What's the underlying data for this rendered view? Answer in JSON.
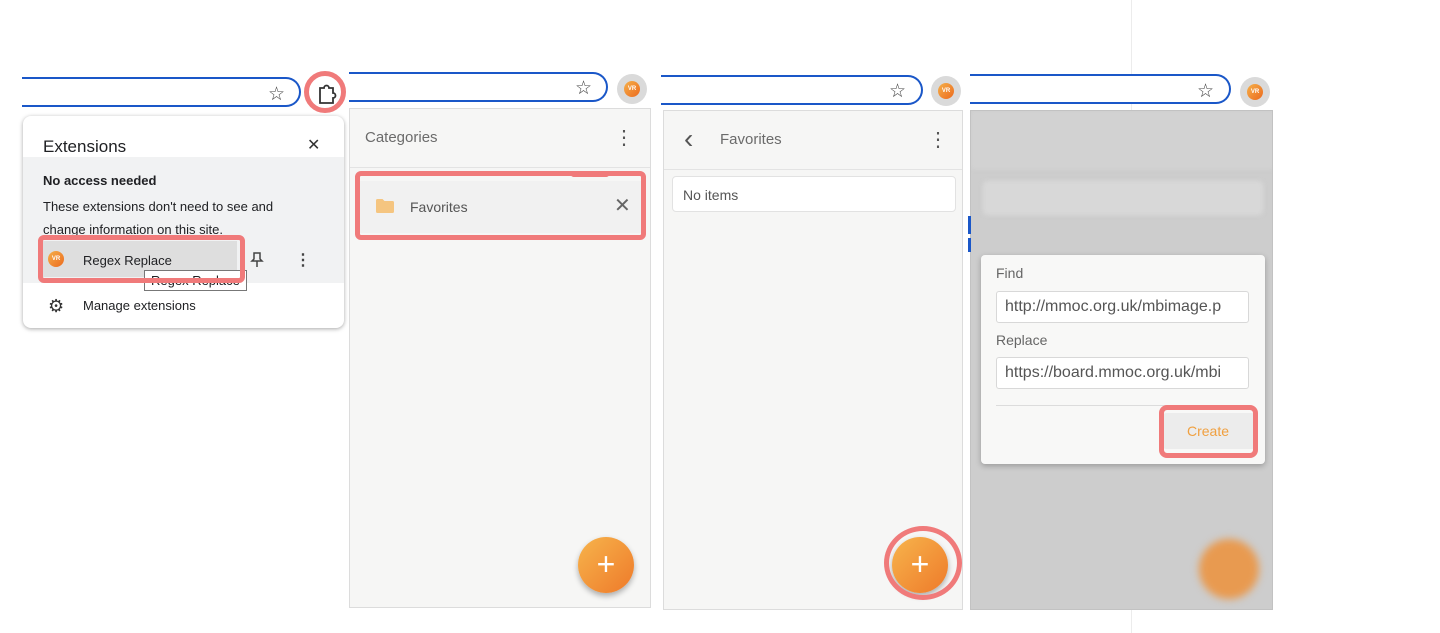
{
  "extensions_popup": {
    "title": "Extensions",
    "section_heading": "No access needed",
    "section_desc": "These extensions don't need to see and change information on this site.",
    "extension_name": "Regex Replace",
    "tooltip": "Regex Replace",
    "manage_label": "Manage extensions",
    "close_glyph": "✕",
    "icons": [
      "puzzle-icon",
      "close-icon",
      "pin-icon",
      "more-vert-icon",
      "gear-icon",
      "star-icon"
    ]
  },
  "avatar_text": "VR",
  "categories_panel": {
    "header_title": "Categories",
    "item_label": "Favorites",
    "item_icon": "folder-icon",
    "remove_glyph": "✕",
    "menu_glyph": "⋮",
    "fab_glyph": "+"
  },
  "favorites_panel": {
    "back_glyph": "‹",
    "header_title": "Favorites",
    "empty_text": "No items",
    "menu_glyph": "⋮",
    "fab_glyph": "+"
  },
  "create_dialog": {
    "find_label": "Find",
    "find_value": "http://mmoc.org.uk/mbimage.p",
    "replace_label": "Replace",
    "replace_value": "https://board.mmoc.org.uk/mbi",
    "create_label": "Create"
  },
  "colors": {
    "accent_orange": "#f0a040",
    "highlight_red": "#f07a7a",
    "omnibox_blue": "#1a57c8"
  }
}
